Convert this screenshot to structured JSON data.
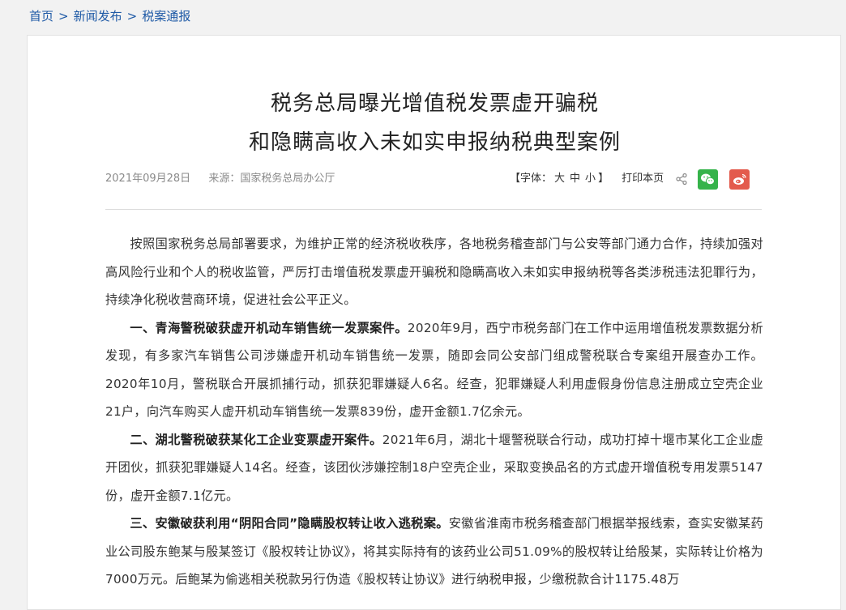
{
  "breadcrumb": {
    "items": [
      "首页",
      "新闻发布",
      "税案通报"
    ],
    "separator": ">"
  },
  "article": {
    "title_line1": "税务总局曝光增值税发票虚开骗税",
    "title_line2": "和隐瞒高收入未如实申报纳税典型案例",
    "date": "2021年09月28日",
    "source": "来源：国家税务总局办公厅"
  },
  "tools": {
    "font_size_label_open": "【字体：",
    "font_large": "大",
    "font_medium": "中",
    "font_small": "小",
    "font_size_label_close": "】",
    "print": "打印本页",
    "icons": [
      "share-icon",
      "wechat-icon",
      "weibo-icon"
    ]
  },
  "paragraphs": [
    {
      "heading": "",
      "text": "按照国家税务总局部署要求，为维护正常的经济税收秩序，各地税务稽查部门与公安等部门通力合作，持续加强对高风险行业和个人的税收监管，严厉打击增值税发票虚开骗税和隐瞒高收入未如实申报纳税等各类涉税违法犯罪行为，持续净化税收营商环境，促进社会公平正义。"
    },
    {
      "heading": "一、青海警税破获虚开机动车销售统一发票案件。",
      "text": "2020年9月，西宁市税务部门在工作中运用增值税发票数据分析发现，有多家汽车销售公司涉嫌虚开机动车销售统一发票，随即会同公安部门组成警税联合专案组开展查办工作。2020年10月，警税联合开展抓捕行动，抓获犯罪嫌疑人6名。经查，犯罪嫌疑人利用虚假身份信息注册成立空壳企业21户，向汽车购买人虚开机动车销售统一发票839份，虚开金额1.7亿余元。"
    },
    {
      "heading": "二、湖北警税破获某化工企业变票虚开案件。",
      "text": "2021年6月，湖北十堰警税联合行动，成功打掉十堰市某化工企业虚开团伙，抓获犯罪嫌疑人14名。经查，该团伙涉嫌控制18户空壳企业，采取变换品名的方式虚开增值税专用发票5147份，虚开金额7.1亿元。"
    },
    {
      "heading": "三、安徽破获利用“阴阳合同”隐瞒股权转让收入逃税案。",
      "text": "安徽省淮南市税务稽查部门根据举报线索，查实安徽某药业公司股东鲍某与殷某签订《股权转让协议》，将其实际持有的该药业公司51.09%的股权转让给殷某，实际转让价格为7000万元。后鲍某为偷逃相关税款另行伪造《股权转让协议》进行纳税申报，少缴税款合计1175.48万"
    }
  ],
  "colors": {
    "link": "#1f5aa6",
    "wechat": "#35b34a",
    "weibo": "#e35b4d",
    "page_bg": "#f2f2f2"
  }
}
